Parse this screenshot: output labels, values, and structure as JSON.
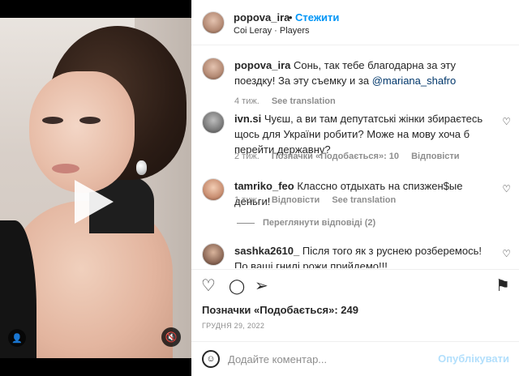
{
  "post": {
    "author": "popova_ira",
    "separator": "•",
    "follow_label": "Стежити",
    "audio": "Coi Leray · Players"
  },
  "comments": [
    {
      "user": "popova_ira",
      "text": "Сонь, так тебе благодарна за эту поездку! За эту съемку и за",
      "mention": "@mariana_shafro",
      "time": "4 тиж.",
      "translate": "See translation"
    },
    {
      "user": "ivn.si",
      "text": "Чуєш, а ви там депутатські жінки збираєтесь щось для України робити? Може на мову хоча б перейти державну?",
      "time": "2 тиж.",
      "likes": "Позначки «Подобається»: 10",
      "reply": "Відповісти"
    },
    {
      "user": "tamriko_feo",
      "text": "Классно отдыхать на спизжен$ые деньги!",
      "time": "1 тиж.",
      "reply": "Відповісти",
      "translate": "See translation",
      "view_replies": "Переглянути відповіді (2)"
    },
    {
      "user": "sashka2610_",
      "text": "Після того як з руснею розберемось! По ваші гнилі рожи прийдемо!!!"
    }
  ],
  "likes_count": "Позначки «Подобається»: 249",
  "date": "ГРУДНЯ 29, 2022",
  "composer": {
    "placeholder": "Додайте коментар...",
    "publish_label": "Опублікувати"
  },
  "icons": {
    "heart": "♡",
    "comment": "◯",
    "share": "➢",
    "save": "⚑",
    "emoji": "☺",
    "mute": "🔇",
    "user_tag": "👤"
  },
  "colors": {
    "accent": "#0095f6",
    "publish_disabled": "#b2dffc",
    "muted_text": "#8e8e8e"
  }
}
